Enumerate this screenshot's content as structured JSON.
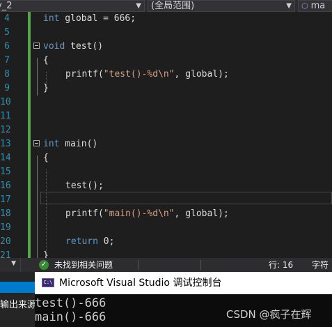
{
  "topbar": {
    "project": "y_2",
    "scope": "(全局范围)",
    "member": "ma"
  },
  "editor": {
    "lines": [
      {
        "n": "4",
        "code": "int global = 666;"
      },
      {
        "n": "5",
        "code": ""
      },
      {
        "n": "6",
        "code": "void test()"
      },
      {
        "n": "7",
        "code": "{"
      },
      {
        "n": "8",
        "code": "printf(\"test()-%d\\n\", global);"
      },
      {
        "n": "9",
        "code": "}"
      },
      {
        "n": "10",
        "code": ""
      },
      {
        "n": "11",
        "code": ""
      },
      {
        "n": "12",
        "code": ""
      },
      {
        "n": "13",
        "code": "int main()"
      },
      {
        "n": "14",
        "code": "{"
      },
      {
        "n": "15",
        "code": ""
      },
      {
        "n": "16",
        "code": "test();"
      },
      {
        "n": "17",
        "code": ""
      },
      {
        "n": "18",
        "code": "printf(\"main()-%d\\n\", global);"
      },
      {
        "n": "19",
        "code": ""
      },
      {
        "n": "20",
        "code": "return 0;"
      },
      {
        "n": "21",
        "code": "}"
      }
    ]
  },
  "status": {
    "issues": "未找到相关问题",
    "line": "行: 16",
    "char": "字符"
  },
  "output_panel": {
    "label": "输出来源"
  },
  "console": {
    "icon_text": "C:\\",
    "title": "Microsoft Visual Studio 调试控制台",
    "output": [
      "test()-666",
      "main()-666"
    ]
  },
  "watermark": "CSDN @疯子在辉",
  "colors": {
    "keyword": "#569cd6",
    "string": "#d69d85",
    "line_number": "#2b91af",
    "change_bar": "#57a64a",
    "status_ok": "#388a34"
  }
}
